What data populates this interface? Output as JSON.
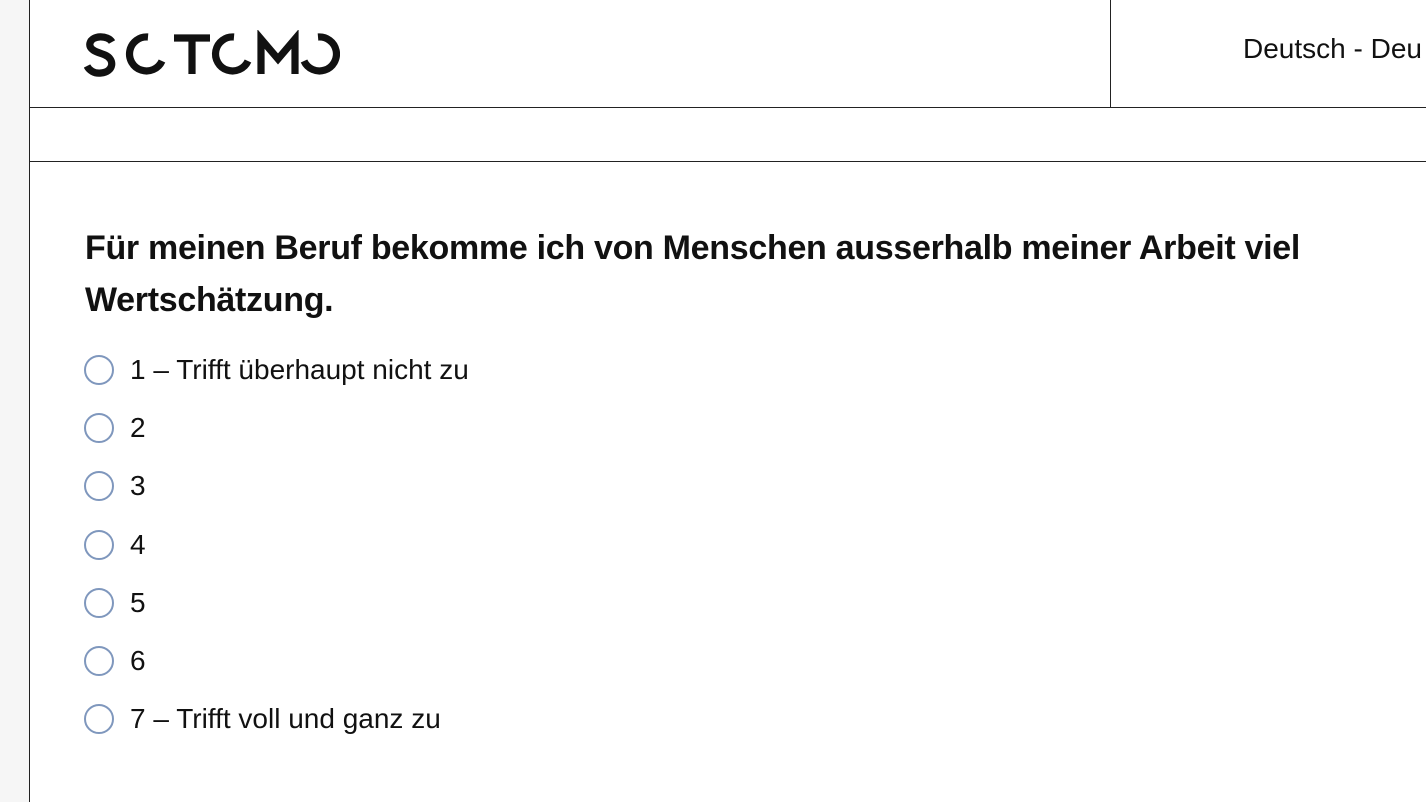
{
  "header": {
    "brand": "SOTOMO",
    "language": "Deutsch - Deu"
  },
  "question": {
    "text": "Für meinen Beruf bekomme ich von Menschen ausserhalb meiner Arbeit viel Wertschätzung."
  },
  "options": [
    {
      "label": "1 – Trifft überhaupt nicht zu"
    },
    {
      "label": "2"
    },
    {
      "label": "3"
    },
    {
      "label": "4"
    },
    {
      "label": "5"
    },
    {
      "label": "6"
    },
    {
      "label": "7 – Trifft voll und ganz zu"
    }
  ],
  "colors": {
    "radio_border": "#7f97bd",
    "text": "#111111",
    "divider": "#222222"
  }
}
